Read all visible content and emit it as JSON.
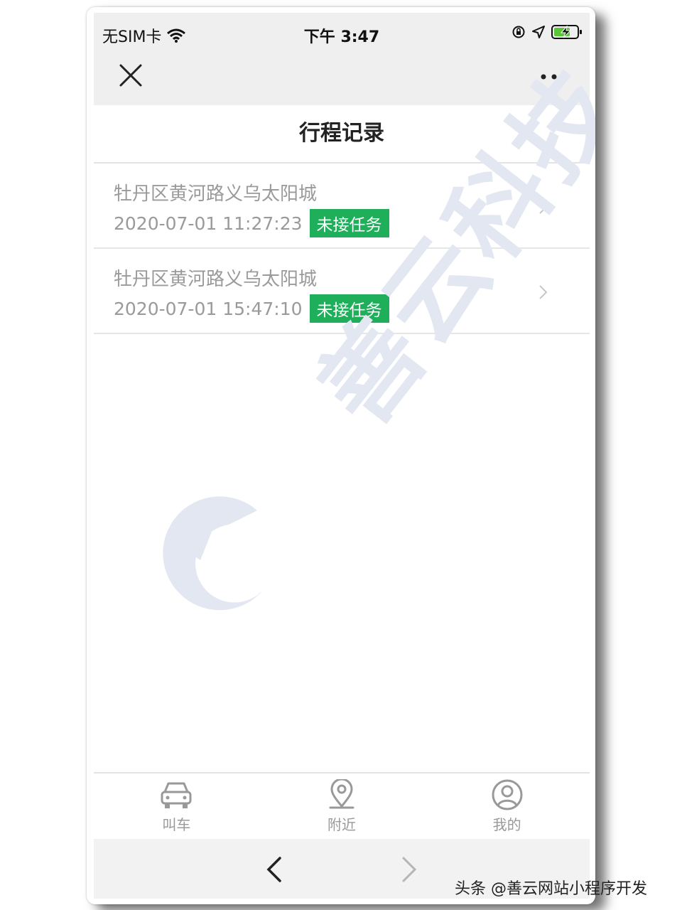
{
  "status_bar": {
    "carrier": "无SIM卡",
    "time": "下午 3:47",
    "wifi_icon": "wifi-icon",
    "lock_icon": "rotation-lock-icon",
    "location_icon": "location-arrow-icon",
    "battery_icon": "battery-charging-icon",
    "battery_color": "#5ac43a"
  },
  "navbar": {
    "close_icon": "close-icon",
    "more_icon": "more-dots-icon"
  },
  "page": {
    "title": "行程记录"
  },
  "trips": [
    {
      "address": "牡丹区黄河路义乌太阳城",
      "datetime": "2020-07-01 11:27:23",
      "status": "未接任务"
    },
    {
      "address": "牡丹区黄河路义乌太阳城",
      "datetime": "2020-07-01 15:47:10",
      "status": "未接任务"
    }
  ],
  "status_color": "#1fae5a",
  "watermark": {
    "text": "善云科技"
  },
  "tabs": [
    {
      "label": "叫车",
      "icon": "car-icon"
    },
    {
      "label": "附近",
      "icon": "map-pin-icon"
    },
    {
      "label": "我的",
      "icon": "user-icon"
    }
  ],
  "browser_nav": {
    "back_icon": "chevron-left-icon",
    "forward_icon": "chevron-right-icon"
  },
  "credit": "头条 @善云网站小程序开发"
}
